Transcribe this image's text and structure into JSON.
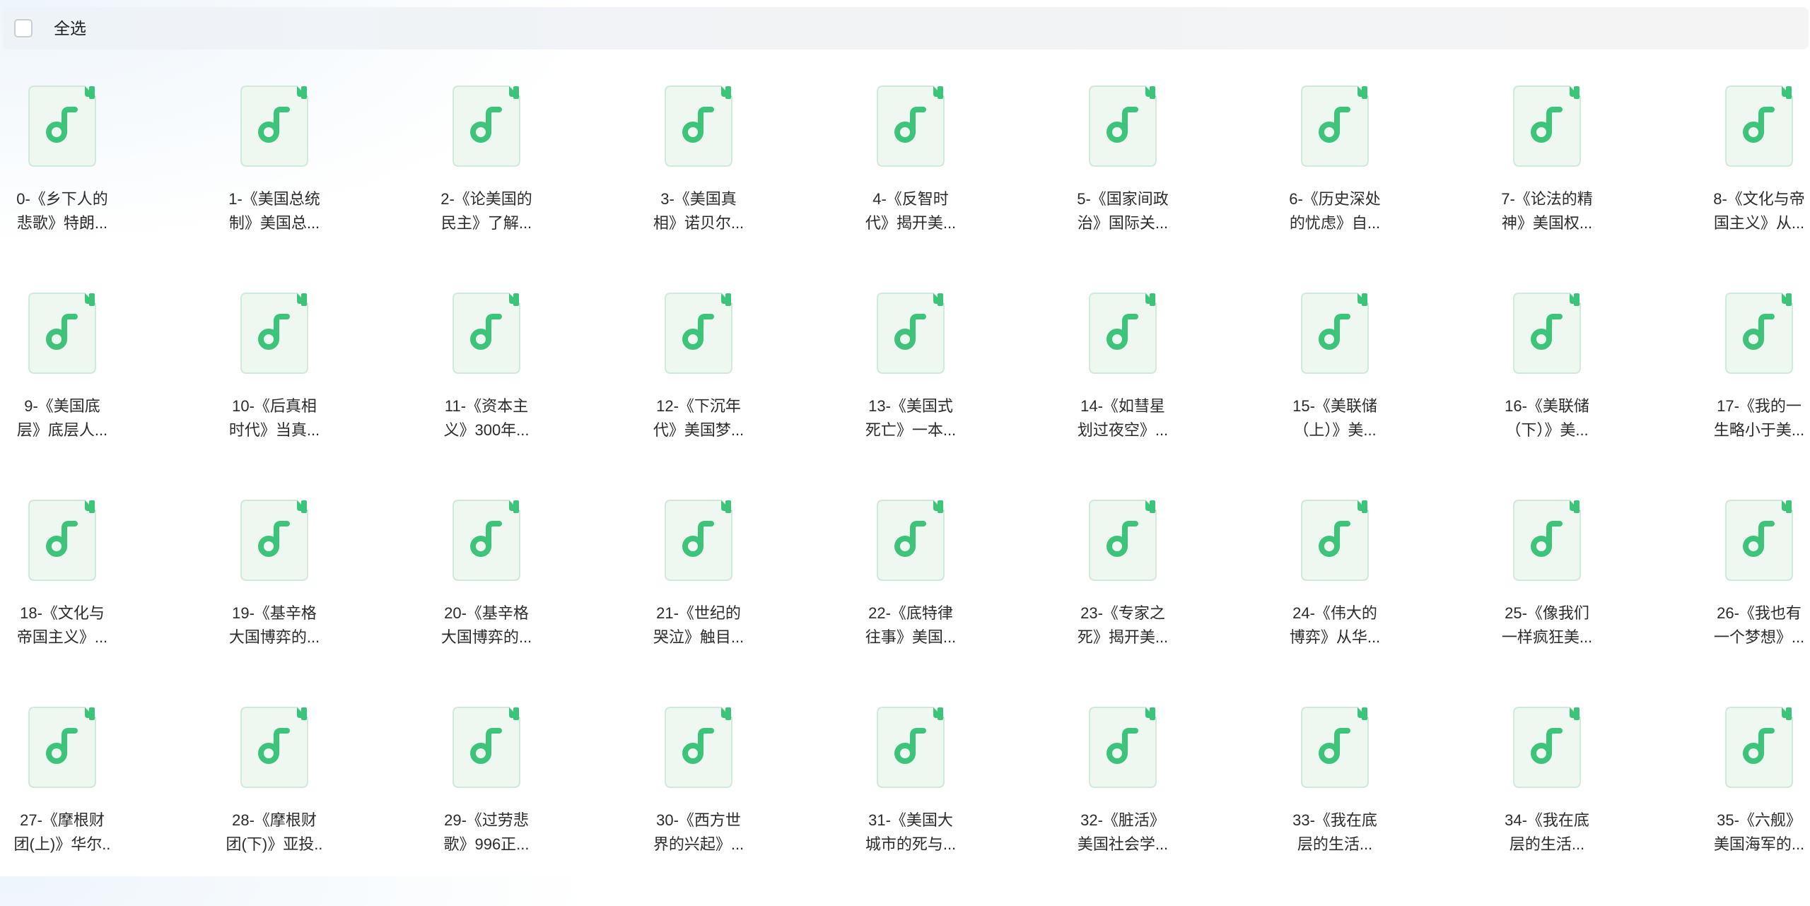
{
  "header": {
    "select_all_label": "全选"
  },
  "colors": {
    "accent": "#3cc57a",
    "icon_bg": "#eef8f1",
    "icon_border": "#cfe9da"
  },
  "files": [
    {
      "line1": "0-《乡下人的",
      "line2": "悲歌》特朗..."
    },
    {
      "line1": "1-《美国总统",
      "line2": "制》美国总..."
    },
    {
      "line1": "2-《论美国的",
      "line2": "民主》了解..."
    },
    {
      "line1": "3-《美国真",
      "line2": "相》诺贝尔..."
    },
    {
      "line1": "4-《反智时",
      "line2": "代》揭开美..."
    },
    {
      "line1": "5-《国家间政",
      "line2": "治》国际关..."
    },
    {
      "line1": "6-《历史深处",
      "line2": "的忧虑》自..."
    },
    {
      "line1": "7-《论法的精",
      "line2": "神》美国权..."
    },
    {
      "line1": "8-《文化与帝",
      "line2": "国主义》从..."
    },
    {
      "line1": "9-《美国底",
      "line2": "层》底层人..."
    },
    {
      "line1": "10-《后真相",
      "line2": "时代》当真..."
    },
    {
      "line1": "11-《资本主",
      "line2": "义》300年..."
    },
    {
      "line1": "12-《下沉年",
      "line2": "代》美国梦..."
    },
    {
      "line1": "13-《美国式",
      "line2": "死亡》一本..."
    },
    {
      "line1": "14-《如彗星",
      "line2": "划过夜空》..."
    },
    {
      "line1": "15-《美联储",
      "line2": "（上）》美..."
    },
    {
      "line1": "16-《美联储",
      "line2": "（下）》美..."
    },
    {
      "line1": "17-《我的一",
      "line2": "生略小于美..."
    },
    {
      "line1": "18-《文化与",
      "line2": "帝国主义》..."
    },
    {
      "line1": "19-《基辛格",
      "line2": "大国博弈的..."
    },
    {
      "line1": "20-《基辛格",
      "line2": "大国博弈的..."
    },
    {
      "line1": "21-《世纪的",
      "line2": "哭泣》触目..."
    },
    {
      "line1": "22-《底特律",
      "line2": "往事》美国..."
    },
    {
      "line1": "23-《专家之",
      "line2": "死》揭开美..."
    },
    {
      "line1": "24-《伟大的",
      "line2": "博弈》从华..."
    },
    {
      "line1": "25-《像我们",
      "line2": "一样疯狂美..."
    },
    {
      "line1": "26-《我也有",
      "line2": "一个梦想》..."
    },
    {
      "line1": "27-《摩根财",
      "line2": "团(上)》华尔.."
    },
    {
      "line1": "28-《摩根财",
      "line2": "团(下)》亚投.."
    },
    {
      "line1": "29-《过劳悲",
      "line2": "歌》996正..."
    },
    {
      "line1": "30-《西方世",
      "line2": "界的兴起》..."
    },
    {
      "line1": "31-《美国大",
      "line2": "城市的死与..."
    },
    {
      "line1": "32-《脏活》",
      "line2": "美国社会学..."
    },
    {
      "line1": "33-《我在底",
      "line2": "层的生活..."
    },
    {
      "line1": "34-《我在底",
      "line2": "层的生活..."
    },
    {
      "line1": "35-《六舰》",
      "line2": "美国海军的..."
    }
  ]
}
